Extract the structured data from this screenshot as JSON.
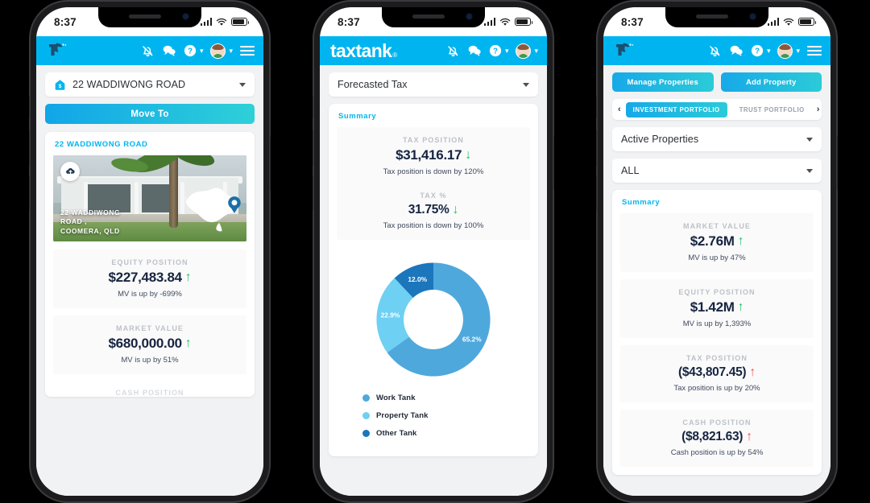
{
  "statusbar": {
    "time": "8:37"
  },
  "header": {
    "logo_text": "taxtank",
    "logo_mark": "®",
    "icons": [
      "bell-off-icon",
      "chat-icon",
      "help-icon",
      "avatar",
      "menu-icon"
    ]
  },
  "colors": {
    "brand_blue": "#00b5ef",
    "gradient_start": "#11a5e8",
    "gradient_end": "#2ed0d8",
    "value_navy": "#16243f",
    "up_green": "#22c55e",
    "up_red": "#f2554d",
    "label_grey": "#bdc1c6"
  },
  "phone1": {
    "property_select": {
      "value": "22 WADDIWONG ROAD",
      "icon": "house-icon"
    },
    "move_button": "Move To",
    "card_title": "22 WADDIWONG ROAD",
    "hero": {
      "address_line1": "22 WADDIWONG",
      "address_line2": "ROAD ,",
      "address_line3": "COOMERA, QLD",
      "upload_icon": "cloud-upload-icon",
      "map_icon": "australia-map-pin"
    },
    "stats": [
      {
        "label": "EQUITY POSITION",
        "value": "$227,483.84",
        "arrow": "up",
        "arrow_color": "green",
        "sub": "MV is up by -699%"
      },
      {
        "label": "MARKET VALUE",
        "value": "$680,000.00",
        "arrow": "up",
        "arrow_color": "green",
        "sub": "MV is up by 51%"
      }
    ],
    "cut_off_label": "CASH POSITION"
  },
  "phone2": {
    "tax_select": {
      "value": "Forecasted Tax"
    },
    "summary_title": "Summary",
    "stats": [
      {
        "label": "TAX POSITION",
        "value": "$31,416.17",
        "arrow": "down",
        "arrow_color": "green",
        "sub": "Tax position is down by 120%"
      },
      {
        "label": "TAX %",
        "value": "31.75%",
        "arrow": "down",
        "arrow_color": "green",
        "sub": "Tax position is down by 100%"
      }
    ],
    "chart_data": {
      "type": "pie",
      "title": "",
      "categories": [
        "Work Tank",
        "Property Tank",
        "Other Tank"
      ],
      "values": [
        65.2,
        22.9,
        12.0
      ],
      "labels": [
        "65.2%",
        "22.9%",
        "12.0%"
      ],
      "colors": [
        "#4ea8dc",
        "#6ed0f2",
        "#1b76bc"
      ],
      "legend_position": "bottom",
      "donut": true,
      "ylabel": "",
      "xlabel": ""
    }
  },
  "phone3": {
    "buttons": {
      "manage": "Manage Properties",
      "add": "Add Property"
    },
    "tabs": [
      {
        "label": "INVESTMENT PORTFOLIO",
        "active": true
      },
      {
        "label": "TRUST PORTFOLIO",
        "active": false
      }
    ],
    "prev_arrow": "‹",
    "next_arrow": "›",
    "filter_status": {
      "value": "Active Properties"
    },
    "filter_all": {
      "value": "ALL"
    },
    "summary_title": "Summary",
    "stats": [
      {
        "label": "MARKET VALUE",
        "value": "$2.76M",
        "arrow": "up",
        "arrow_color": "green",
        "sub": "MV is up by 47%"
      },
      {
        "label": "EQUITY POSITION",
        "value": "$1.42M",
        "arrow": "up",
        "arrow_color": "green",
        "sub": "MV is up by 1,393%"
      },
      {
        "label": "TAX POSITION",
        "value": "($43,807.45)",
        "arrow": "up",
        "arrow_color": "red",
        "sub": "Tax position is up by 20%"
      },
      {
        "label": "CASH POSITION",
        "value": "($8,821.63)",
        "arrow": "up",
        "arrow_color": "red",
        "sub": "Cash position is up by 54%"
      }
    ]
  }
}
